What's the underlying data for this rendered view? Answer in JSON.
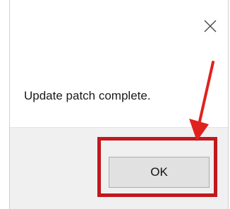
{
  "dialog": {
    "message": "Update patch complete.",
    "ok_label": "OK",
    "close_icon": "close-icon"
  },
  "annotation": {
    "highlight_color": "#c0191e",
    "arrow_color": "#e0221f"
  }
}
